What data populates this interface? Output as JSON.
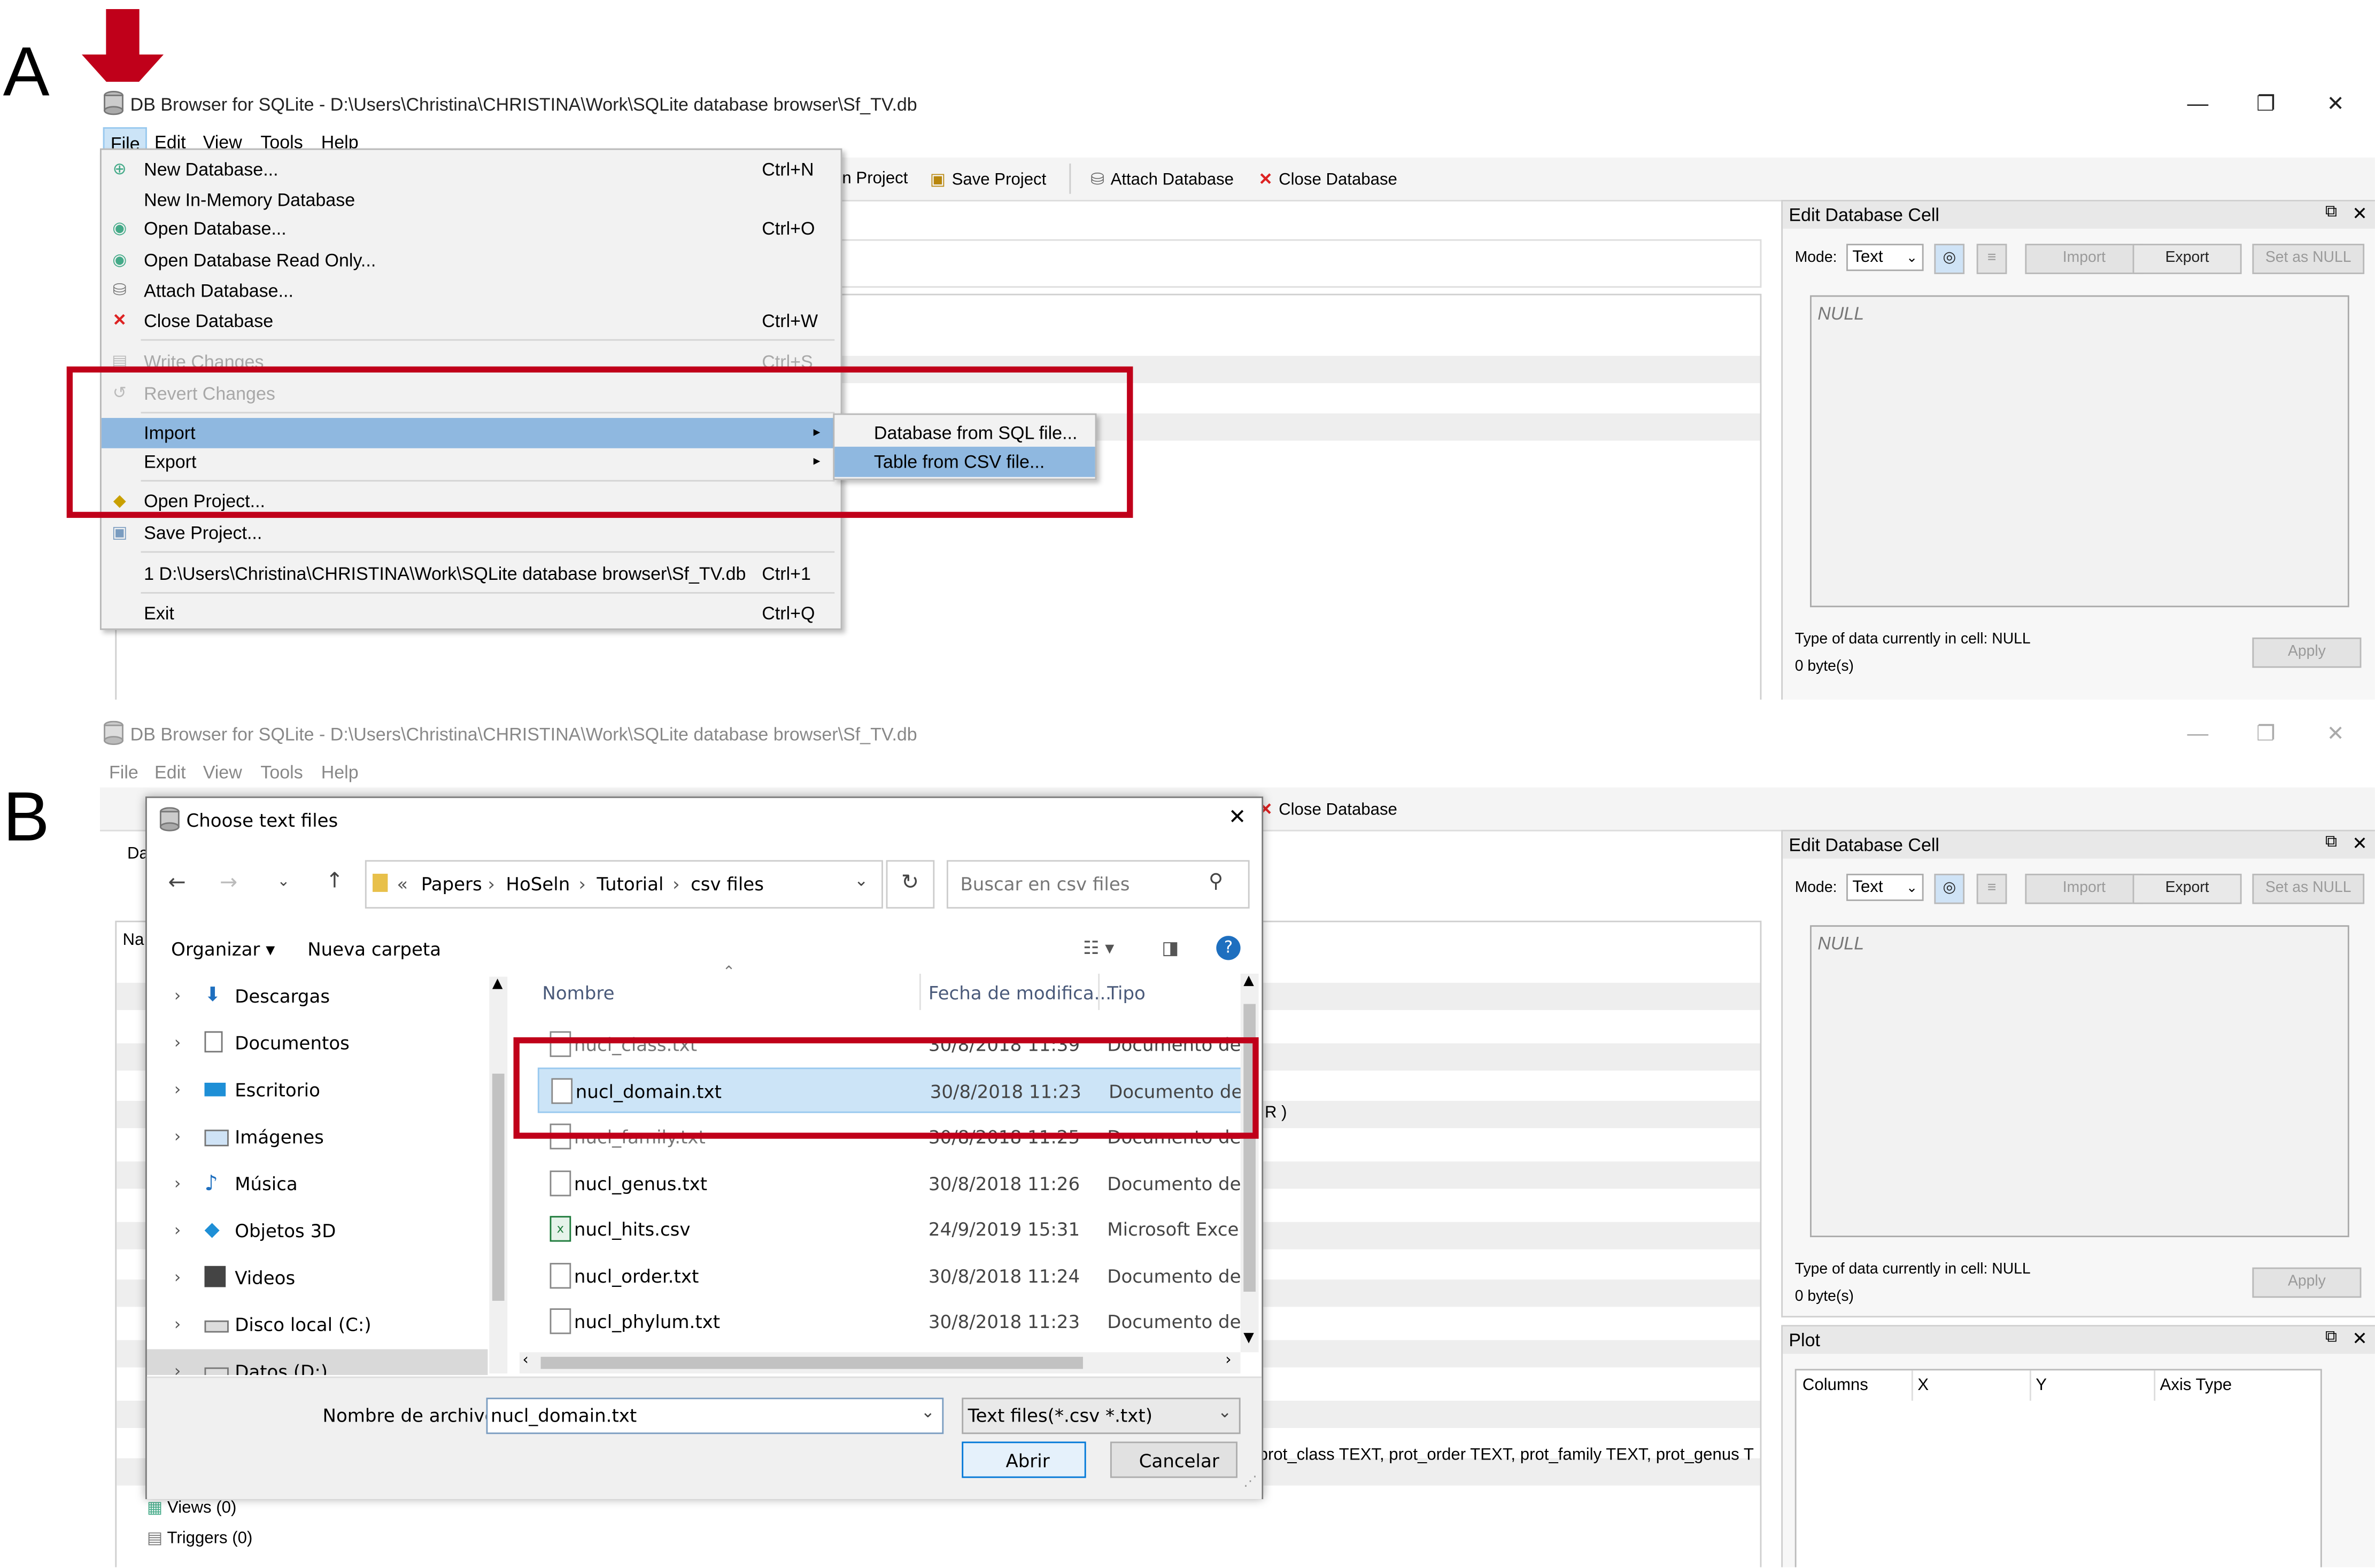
{
  "panels": {
    "a_label": "A",
    "b_label": "B"
  },
  "window": {
    "title": "DB Browser for SQLite - D:\\Users\\Christina\\CHRISTINA\\Work\\SQLite database browser\\Sf_TV.db",
    "minimize_glyph": "—",
    "maximize_glyph": "❐",
    "close_glyph": "✕",
    "app_icon": "database-icon"
  },
  "menubar": [
    "File",
    "Edit",
    "View",
    "Tools",
    "Help"
  ],
  "toolbar": {
    "open_project": "n Project",
    "save_project": "Save Project",
    "attach_database": "Attach Database",
    "close_database": "Close Database"
  },
  "file_menu": {
    "items": [
      {
        "label": "New Database...",
        "shortcut": "Ctrl+N",
        "icon": "new-db-icon"
      },
      {
        "label": "New In-Memory Database",
        "shortcut": "",
        "icon": ""
      },
      {
        "label": "Open Database...",
        "shortcut": "Ctrl+O",
        "icon": "open-db-icon"
      },
      {
        "label": "Open Database Read Only...",
        "shortcut": "",
        "icon": "open-db-readonly-icon"
      },
      {
        "label": "Attach Database...",
        "shortcut": "",
        "icon": "attach-db-icon"
      },
      {
        "label": "Close Database",
        "shortcut": "Ctrl+W",
        "icon": "close-db-icon"
      },
      {
        "label": "Write Changes",
        "shortcut": "Ctrl+S",
        "icon": "write-changes-icon"
      },
      {
        "label": "Revert Changes",
        "shortcut": "",
        "icon": "revert-changes-icon"
      },
      {
        "label": "Import",
        "shortcut": "",
        "icon": ""
      },
      {
        "label": "Export",
        "shortcut": "",
        "icon": ""
      },
      {
        "label": "Open Project...",
        "shortcut": "",
        "icon": "open-project-icon"
      },
      {
        "label": "Save Project...",
        "shortcut": "",
        "icon": "save-project-icon"
      },
      {
        "label": "1 D:\\Users\\Christina\\CHRISTINA\\Work\\SQLite database browser\\Sf_TV.db",
        "shortcut": "Ctrl+1",
        "icon": ""
      },
      {
        "label": "Exit",
        "shortcut": "Ctrl+Q",
        "icon": ""
      }
    ]
  },
  "import_submenu": [
    "Database from SQL file...",
    "Table from CSV file..."
  ],
  "edit_cell": {
    "title": "Edit Database Cell",
    "mode_label": "Mode:",
    "mode_value": "Text",
    "import": "Import",
    "export": "Export",
    "set_null": "Set as NULL",
    "value": "NULL",
    "type_info": "Type of data currently in cell: NULL",
    "size_info": "0 byte(s)",
    "apply": "Apply"
  },
  "plot": {
    "title": "Plot",
    "columns": [
      "Columns",
      "X",
      "Y",
      "Axis Type"
    ]
  },
  "main_b": {
    "partial_texts": [
      "Da",
      "Na",
      "R )",
      "prot_class TEXT, prot_order TEXT, prot_family TEXT, prot_genus T"
    ],
    "tree_bottom": [
      "Views (0)",
      "Triggers (0)"
    ]
  },
  "dialog": {
    "title": "Choose text files",
    "breadcrumb": [
      "«",
      "Papers",
      "HoSeln",
      "Tutorial",
      "csv files"
    ],
    "search_placeholder": "Buscar en csv files",
    "organize": "Organizar ▾",
    "new_folder": "Nueva carpeta",
    "help_glyph": "?",
    "columns": {
      "name": "Nombre",
      "date": "Fecha de modifica...",
      "type": "Tipo"
    },
    "sidebar": [
      {
        "label": "Descargas",
        "icon": "downloads-icon"
      },
      {
        "label": "Documentos",
        "icon": "documents-icon"
      },
      {
        "label": "Escritorio",
        "icon": "desktop-icon"
      },
      {
        "label": "Imágenes",
        "icon": "pictures-icon"
      },
      {
        "label": "Música",
        "icon": "music-icon"
      },
      {
        "label": "Objetos 3D",
        "icon": "objects-3d-icon"
      },
      {
        "label": "Videos",
        "icon": "videos-icon"
      },
      {
        "label": "Disco local (C:)",
        "icon": "drive-icon"
      },
      {
        "label": "Datos (D:)",
        "icon": "drive-icon"
      }
    ],
    "files": [
      {
        "name": "nucl_class.txt",
        "date": "30/8/2018 11:39",
        "type": "Documento de te",
        "icon": "text-file-icon"
      },
      {
        "name": "nucl_domain.txt",
        "date": "30/8/2018 11:23",
        "type": "Documento de te",
        "icon": "text-file-icon"
      },
      {
        "name": "nucl_family.txt",
        "date": "30/8/2018 11:25",
        "type": "Documento de te",
        "icon": "text-file-icon"
      },
      {
        "name": "nucl_genus.txt",
        "date": "30/8/2018 11:26",
        "type": "Documento de te",
        "icon": "text-file-icon"
      },
      {
        "name": "nucl_hits.csv",
        "date": "24/9/2019 15:31",
        "type": "Microsoft Excel C",
        "icon": "excel-file-icon"
      },
      {
        "name": "nucl_order.txt",
        "date": "30/8/2018 11:24",
        "type": "Documento de te",
        "icon": "text-file-icon"
      },
      {
        "name": "nucl_phylum.txt",
        "date": "30/8/2018 11:23",
        "type": "Documento de te",
        "icon": "text-file-icon"
      }
    ],
    "filename_label": "Nombre de archivo:",
    "filename_value": "nucl_domain.txt",
    "filter_value": "Text files(*.csv *.txt)",
    "open": "Abrir",
    "cancel": "Cancelar"
  },
  "colors": {
    "highlight_red": "#c0001a",
    "menu_highlight": "#8fb8e0",
    "selection": "#cce4f7"
  }
}
